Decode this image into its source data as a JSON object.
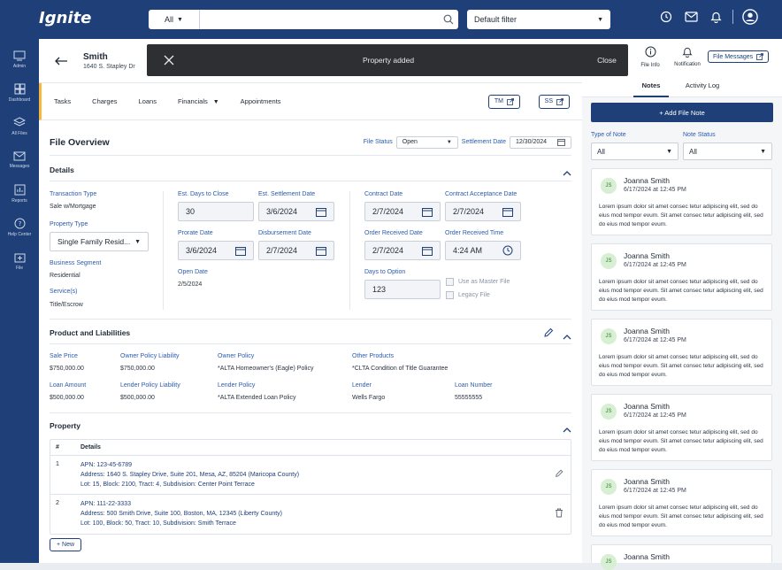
{
  "app": {
    "logo": "Ignite"
  },
  "search": {
    "scope": "All",
    "placeholder": ""
  },
  "filter": {
    "selected": "Default filter"
  },
  "sidenav": {
    "items": [
      "Admin",
      "Dashboard",
      "All Files",
      "Messages",
      "Reports",
      "Help Center",
      "File"
    ]
  },
  "file": {
    "name": "Smith",
    "address": "1640 S. Stapley Dr"
  },
  "toast": {
    "message": "Property added",
    "close": "Close"
  },
  "tabs": {
    "items": [
      "Tasks",
      "Charges",
      "Loans",
      "Financials",
      "Appointments"
    ],
    "tm": "TM",
    "ss": "SS"
  },
  "overview": {
    "title": "File Overview",
    "status_label": "File Status",
    "status_value": "Open",
    "settlement_label": "Settlement Date",
    "settlement_value": "12/30/2024"
  },
  "details": {
    "title": "Details",
    "transaction_type_label": "Transaction Type",
    "transaction_type": "Sale w/Mortgage",
    "property_type_label": "Property Type",
    "property_type": "Single Family Resid...",
    "business_segment_label": "Business Segment",
    "business_segment": "Residential",
    "services_label": "Service(s)",
    "services": "Title/Escrow",
    "est_days_label": "Est. Days to Close",
    "est_days": "30",
    "est_settlement_label": "Est. Settlement Date",
    "est_settlement": "3/6/2024",
    "prorate_label": "Prorate Date",
    "prorate": "3/6/2024",
    "disbursement_label": "Disbursement Date",
    "disbursement": "2/7/2024",
    "open_label": "Open Date",
    "open": "2/5/2024",
    "contract_label": "Contract Date",
    "contract": "2/7/2024",
    "contract_acc_label": "Contract Acceptance Date",
    "contract_acc": "2/7/2024",
    "order_received_label": "Order Received Date",
    "order_received": "2/7/2024",
    "order_time_label": "Order Received Time",
    "order_time": "4:24 AM",
    "days_option_label": "Days to Option",
    "days_option": "123",
    "master_file": "Use as Master File",
    "legacy_file": "Legacy File"
  },
  "product": {
    "title": "Product and Liabilities",
    "sale_price_label": "Sale Price",
    "sale_price": "$750,000.00",
    "owner_liab_label": "Owner Policy Liability",
    "owner_liab": "$750,000.00",
    "owner_policy_label": "Owner Policy",
    "owner_policy": "*ALTA Homeowner's (Eagle) Policy",
    "other_label": "Other Products",
    "other": "*CLTA Condition of Title Guarantee",
    "loan_amount_label": "Loan Amount",
    "loan_amount": "$500,000.00",
    "lender_liab_label": "Lender Policy Liability",
    "lender_liab": "$500,000.00",
    "lender_policy_label": "Lender Policy",
    "lender_policy": "*ALTA Extended Loan Policy",
    "lender_label": "Lender",
    "lender": "Wells Fargo",
    "loan_number_label": "Loan Number",
    "loan_number": "55555555"
  },
  "property": {
    "title": "Property",
    "col_num": "#",
    "col_details": "Details",
    "rows": [
      {
        "num": "1",
        "apn_label": "APN:",
        "apn": "123-45-6789",
        "addr_label": "Address:",
        "addr": "1640 S. Stapley Drive, Suite 201, Mesa, AZ, 85204 (Maricopa County)",
        "lot_label": "Lot:",
        "lot": "15",
        "block_label": "Block:",
        "block": "2100",
        "tract_label": "Tract:",
        "tract": "4",
        "sub_label": "Subdivision:",
        "sub": "Center Point Terrace"
      },
      {
        "num": "2",
        "apn_label": "APN:",
        "apn": "111-22-3333",
        "addr_label": "Address:",
        "addr": "500 Smith Drive, Suite 100, Boston, MA, 12345 (Liberty County)",
        "lot_label": "Lot:",
        "lot": "100",
        "block_label": "Block:",
        "block": "50",
        "tract_label": "Tract:",
        "tract": "10",
        "sub_label": "Subdivision:",
        "sub": "Smith Terrace"
      }
    ],
    "new_label": "+ New"
  },
  "right_panel": {
    "file_info": "File Info",
    "notification": "Notification",
    "file_messages": "File Messages",
    "tab_notes": "Notes",
    "tab_activity": "Activity Log",
    "add_note": "+ Add File Note",
    "type_label": "Type of Note",
    "type_value": "All",
    "status_label": "Note Status",
    "status_value": "All",
    "notes": [
      {
        "initials": "JS",
        "name": "Joanna Smith",
        "date": "6/17/2024 at 12:45 PM",
        "body": "Lorem ipsum dolor sit amet consec tetur adipiscing elit, sed do eius mod tempor evum. Sit amet consec tetur adipiscing elit, sed do eius mod tempor evum."
      },
      {
        "initials": "JS",
        "name": "Joanna Smith",
        "date": "6/17/2024 at 12:45 PM",
        "body": "Lorem ipsum dolor sit amet consec tetur adipiscing elit, sed do eius mod tempor evum. Sit amet consec tetur adipiscing elit, sed do eius mod tempor evum."
      },
      {
        "initials": "JS",
        "name": "Joanna Smith",
        "date": "6/17/2024 at 12:45 PM",
        "body": "Lorem ipsum dolor sit amet consec tetur adipiscing elit, sed do eius mod tempor evum. Sit amet consec tetur adipiscing elit, sed do eius mod tempor evum."
      },
      {
        "initials": "JS",
        "name": "Joanna Smith",
        "date": "6/17/2024 at 12:45 PM",
        "body": "Lorem ipsum dolor sit amet consec tetur adipiscing elit, sed do eius mod tempor evum. Sit amet consec tetur adipiscing elit, sed do eius mod tempor evum."
      },
      {
        "initials": "JS",
        "name": "Joanna Smith",
        "date": "6/17/2024 at 12:45 PM",
        "body": "Lorem ipsum dolor sit amet consec tetur adipiscing elit, sed do eius mod tempor evum. Sit amet consec tetur adipiscing elit, sed do eius mod tempor evum."
      },
      {
        "initials": "JS",
        "name": "Joanna Smith",
        "date": ""
      }
    ]
  }
}
